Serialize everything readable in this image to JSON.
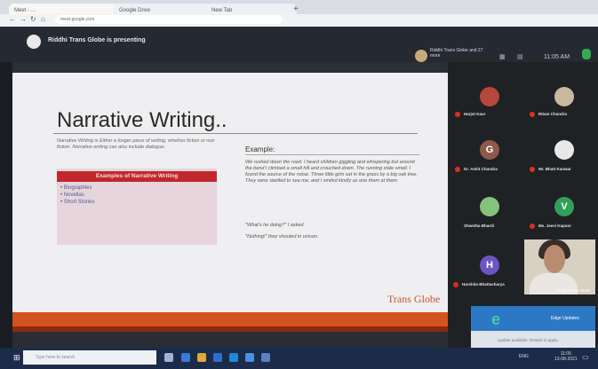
{
  "browser": {
    "tabs": [
      "Meet - ...",
      "Google Drive",
      "New Tab"
    ],
    "url": "meet.google.com"
  },
  "meeting": {
    "presenter_text": "Riddhi Trans Globe is presenting",
    "owner_name": "Riddhi Trans Globe and 27 more",
    "time": "11:05 AM"
  },
  "slide": {
    "title": "Narrative Writing..",
    "intro": "Narrative Writing is Either a longer piece of writing, whether fiction or non fiction. Narrative writing can also include dialogue.",
    "examples_heading": "Examples of Narrative Writing",
    "examples": [
      "Biographies",
      "Novellas",
      "Short Stories"
    ],
    "example_heading": "Example:",
    "example_body": "We rushed down the road. I heard children giggling and whispering but around the bend I climbed a small hill and crouched down. The running stale smell. I found the source of the noise. Three little girls sat in the grass by a big oak tree. They were startled to see me, and I smiled kindly as one them at them.",
    "quote1": "\"What's he doing?\" I asked.",
    "quote2": "\"Nothing!\" they shouted in unison.",
    "brand": "Trans Globe"
  },
  "participants": [
    {
      "name": "Harjot Kaur",
      "color": "#b5483a",
      "initial": ""
    },
    {
      "name": "Ritam Chandra",
      "color": "#c9b7a0",
      "initial": ""
    },
    {
      "name": "Dr. Ankit Chandra",
      "color": "#8d5b4a",
      "initial": "G"
    },
    {
      "name": "Mr. Bhatt Kanwar",
      "color": "#e8e8e8",
      "initial": ""
    },
    {
      "name": "Shwetha Bhardi",
      "color": "#86c37a",
      "initial": ""
    },
    {
      "name": "Ms. Jeevi Kapoor",
      "color": "#31a05a",
      "initial": "V"
    },
    {
      "name": "Harshita Bhattacharya",
      "color": "#6c55c2",
      "initial": "H"
    }
  ],
  "self_view": {
    "name": "Riddhi Trans Globe"
  },
  "toast": {
    "title": "Edge Updates",
    "text": "Update available. Restart to apply."
  },
  "taskbar": {
    "search_placeholder": "Type here to search",
    "tray": "ENG",
    "time": "11:05",
    "date": "13-08-2021"
  }
}
